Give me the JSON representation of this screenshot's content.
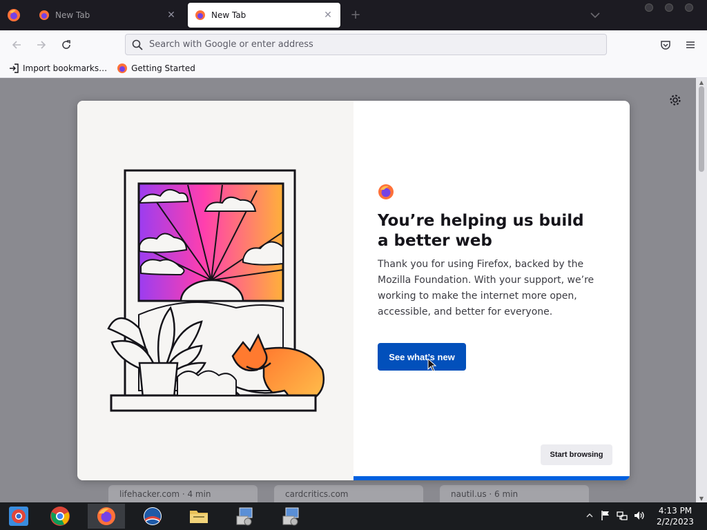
{
  "browser": {
    "tabs": [
      {
        "title": "New Tab",
        "active": false
      },
      {
        "title": "New Tab",
        "active": true
      }
    ],
    "newtab_symbol": "+",
    "close_symbol": "✕"
  },
  "nav": {
    "url_placeholder": "Search with Google or enter address"
  },
  "bookmarks": [
    {
      "label": "Import bookmarks…",
      "icon": "import-icon"
    },
    {
      "label": "Getting Started",
      "icon": "firefox-icon"
    }
  ],
  "modal": {
    "heading": "You’re helping us build a better web",
    "body": "Thank you for using Firefox, backed by the Mozilla Foundation. With your support, we’re working to make the internet more open, accessible, and better for everyone.",
    "primary_label": "See what’s new",
    "secondary_label": "Start browsing",
    "progress_fraction": 0.5
  },
  "tiles": [
    {
      "label": "lifehacker.com · 4 min"
    },
    {
      "label": "cardcritics.com"
    },
    {
      "label": "nautil.us · 6 min"
    }
  ],
  "taskbar": {
    "time": "4:13 PM",
    "date": "2/2/2023",
    "apps": [
      "chrome-alt-icon",
      "chrome-icon",
      "firefox-icon",
      "obama-icon",
      "file-explorer-icon",
      "installer-icon",
      "installer-icon"
    ]
  },
  "colors": {
    "primary_button": "#0250bb",
    "accent_bar": "#0060df",
    "backdrop": "#8a8a90"
  }
}
